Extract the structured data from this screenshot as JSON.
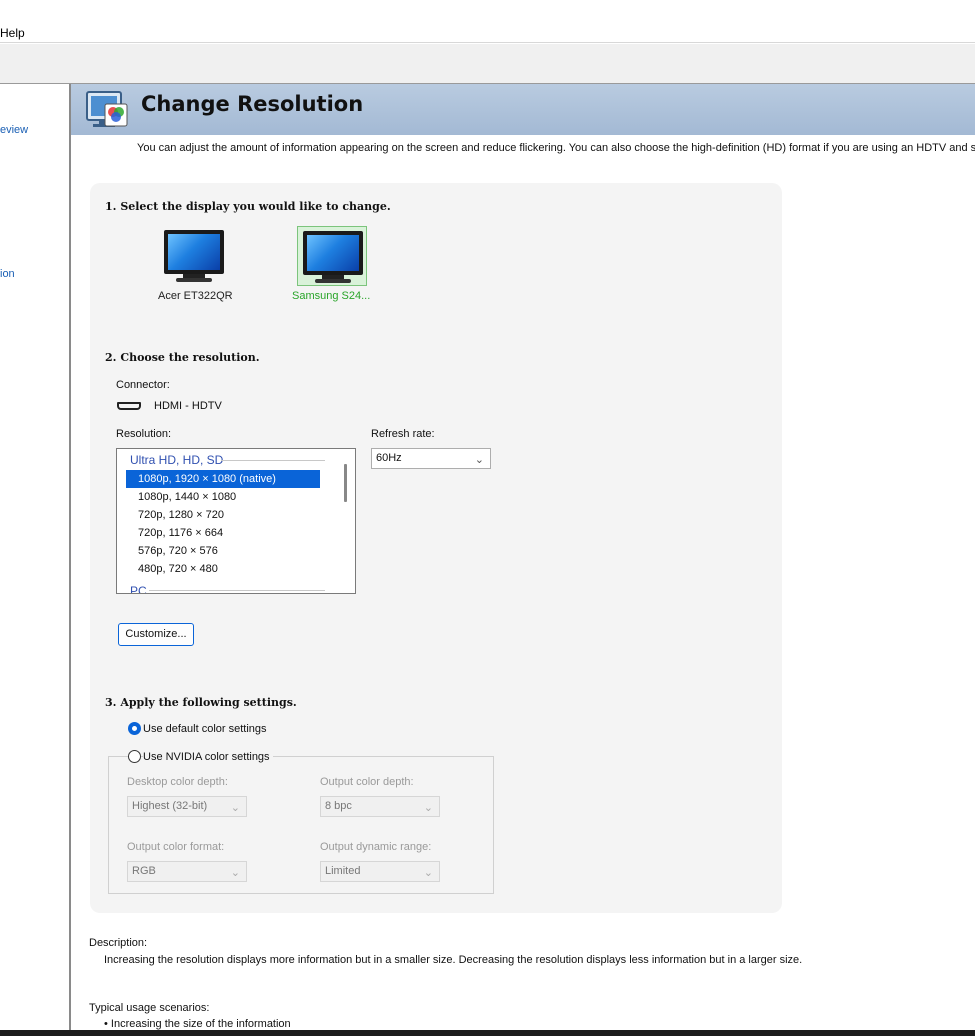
{
  "menu": {
    "help": "Help"
  },
  "sidebar": {
    "items": [
      {
        "label": "eview"
      },
      {
        "label": "ion"
      }
    ]
  },
  "header": {
    "title": "Change Resolution",
    "description": "You can adjust the amount of information appearing on the screen and reduce flickering. You can also choose the high-definition (HD) format if you are using an HDTV and set a c"
  },
  "step1": {
    "heading": "1. Select the display you would like to change.",
    "displays": [
      {
        "label": "Acer ET322QR",
        "selected": false
      },
      {
        "label": "Samsung S24...",
        "selected": true
      }
    ]
  },
  "step2": {
    "heading": "2. Choose the resolution.",
    "connector_label": "Connector:",
    "connector_value": "HDMI - HDTV",
    "resolution_label": "Resolution:",
    "resolution_groups": [
      "Ultra HD, HD, SD",
      "PC"
    ],
    "resolutions": [
      "1080p, 1920 × 1080 (native)",
      "1080p, 1440 × 1080",
      "720p, 1280 × 720",
      "720p, 1176 × 664",
      "576p, 720 × 576",
      "480p, 720 × 480"
    ],
    "selected_resolution": "1080p, 1920 × 1080 (native)",
    "refresh_label": "Refresh rate:",
    "refresh_value": "60Hz",
    "customize_label": "Customize..."
  },
  "step3": {
    "heading": "3. Apply the following settings.",
    "default_color_label": "Use default color settings",
    "nvidia_color_label": "Use NVIDIA color settings",
    "selected_option": "Use default color settings",
    "desktop_depth_label": "Desktop color depth:",
    "desktop_depth_value": "Highest (32-bit)",
    "output_depth_label": "Output color depth:",
    "output_depth_value": "8 bpc",
    "output_format_label": "Output color format:",
    "output_format_value": "RGB",
    "dynamic_range_label": "Output dynamic range:",
    "dynamic_range_value": "Limited"
  },
  "description": {
    "title": "Description:",
    "text": "Increasing the resolution displays more information but in a smaller size. Decreasing the resolution displays less information but in a larger size."
  },
  "usage": {
    "title": "Typical usage scenarios:",
    "items": [
      "• Increasing the size of the information"
    ]
  },
  "colors": {
    "header_bg": "#a9bed8",
    "selection_blue": "#0a64d8",
    "selected_display_text": "#2aa52a"
  }
}
